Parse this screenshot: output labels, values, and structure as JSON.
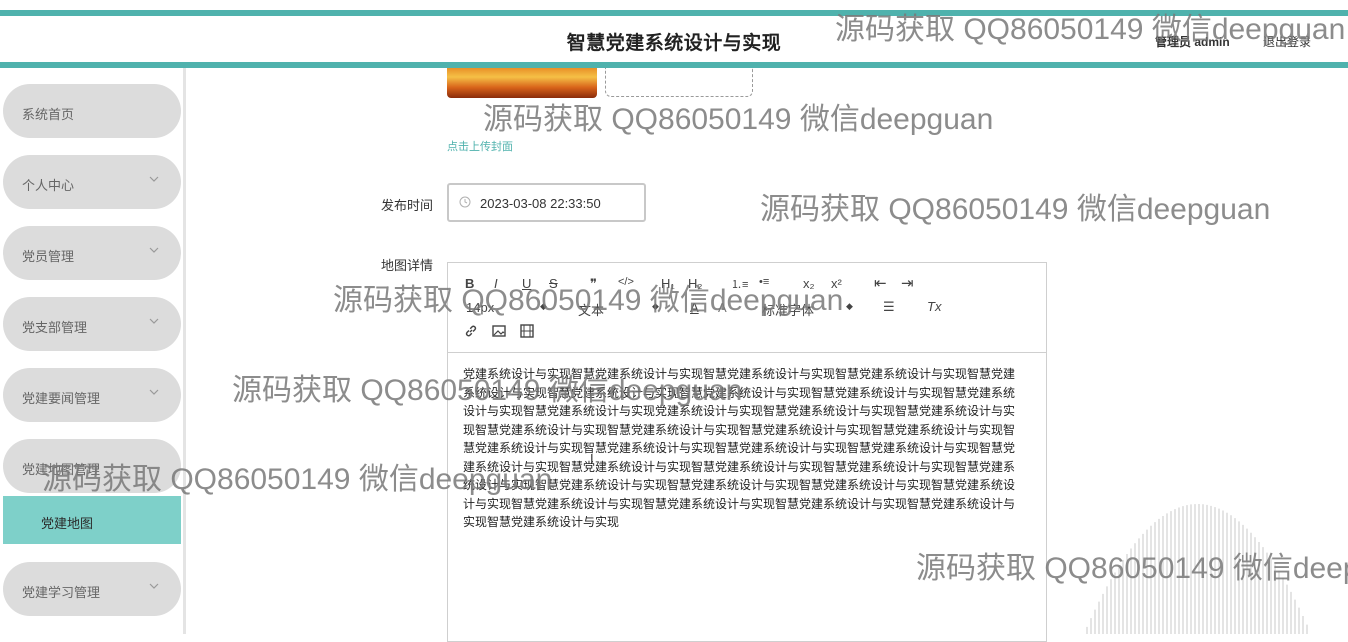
{
  "header": {
    "title": "智慧党建系统设计与实现",
    "user": "管理员 admin",
    "logout": "退出登录"
  },
  "sidebar": {
    "items": [
      {
        "label": "系统首页",
        "chevron": false
      },
      {
        "label": "个人中心",
        "chevron": true
      },
      {
        "label": "党员管理",
        "chevron": true
      },
      {
        "label": "党支部管理",
        "chevron": true
      },
      {
        "label": "党建要闻管理",
        "chevron": true
      },
      {
        "label": "党建地图管理",
        "chevron": false
      },
      {
        "label": "党建学习管理",
        "chevron": true
      }
    ],
    "active_sub": "党建地图"
  },
  "form": {
    "upload_hint": "点击上传封面",
    "publish_time_label": "发布时间",
    "publish_time_value": "2023-03-08 22:33:50",
    "detail_label": "地图详情"
  },
  "editor": {
    "font_size": "14px",
    "block_type": "文本",
    "font_family": "标准字体",
    "content": "党建系统设计与实现智慧党建系统设计与实现智慧党建系统设计与实现智慧党建系统设计与实现智慧党建系统设计与实现智慧党建系统设计与实现智慧党建系统设计与实现智慧党建系统设计与实现智慧党建系统设计与实现智慧党建系统设计与实现党建系统设计与实现智慧党建系统设计与实现智慧党建系统设计与实现智慧党建系统设计与实现智慧党建系统设计与实现智慧党建系统设计与实现智慧党建系统设计与实现智慧党建系统设计与实现智慧党建系统设计与实现智慧党建系统设计与实现智慧党建系统设计与实现智慧党建系统设计与实现智慧党建系统设计与实现智慧党建系统设计与实现智慧党建系统设计与实现智慧党建系统设计与实现智慧党建系统设计与实现智慧党建系统设计与实现智慧党建系统设计与实现智慧党建系统设计与实现智慧党建系统设计与实现智慧党建系统设计与实现智慧党建系统设计与实现智慧党建系统设计与实现智慧党建系统设计与实现"
  },
  "toolbar": {
    "bold": "B",
    "italic": "I",
    "underline": "U",
    "strike": "S",
    "quote": "❞",
    "code": "</>",
    "h1": "H₁",
    "h2": "H₂",
    "ol": "⒈≡",
    "ul": "•≡",
    "sub": "x₂",
    "sup": "x²",
    "outdent": "⇤",
    "indent": "⇥",
    "color": "A",
    "bg": "A",
    "align": "☰",
    "clear": "Tx"
  },
  "watermark": "源码获取 QQ86050149 微信deepguan",
  "colors": {
    "accent": "#4fb2ad",
    "submenu_active": "#7ed0c9",
    "menu_bg": "#dcdcdc"
  }
}
